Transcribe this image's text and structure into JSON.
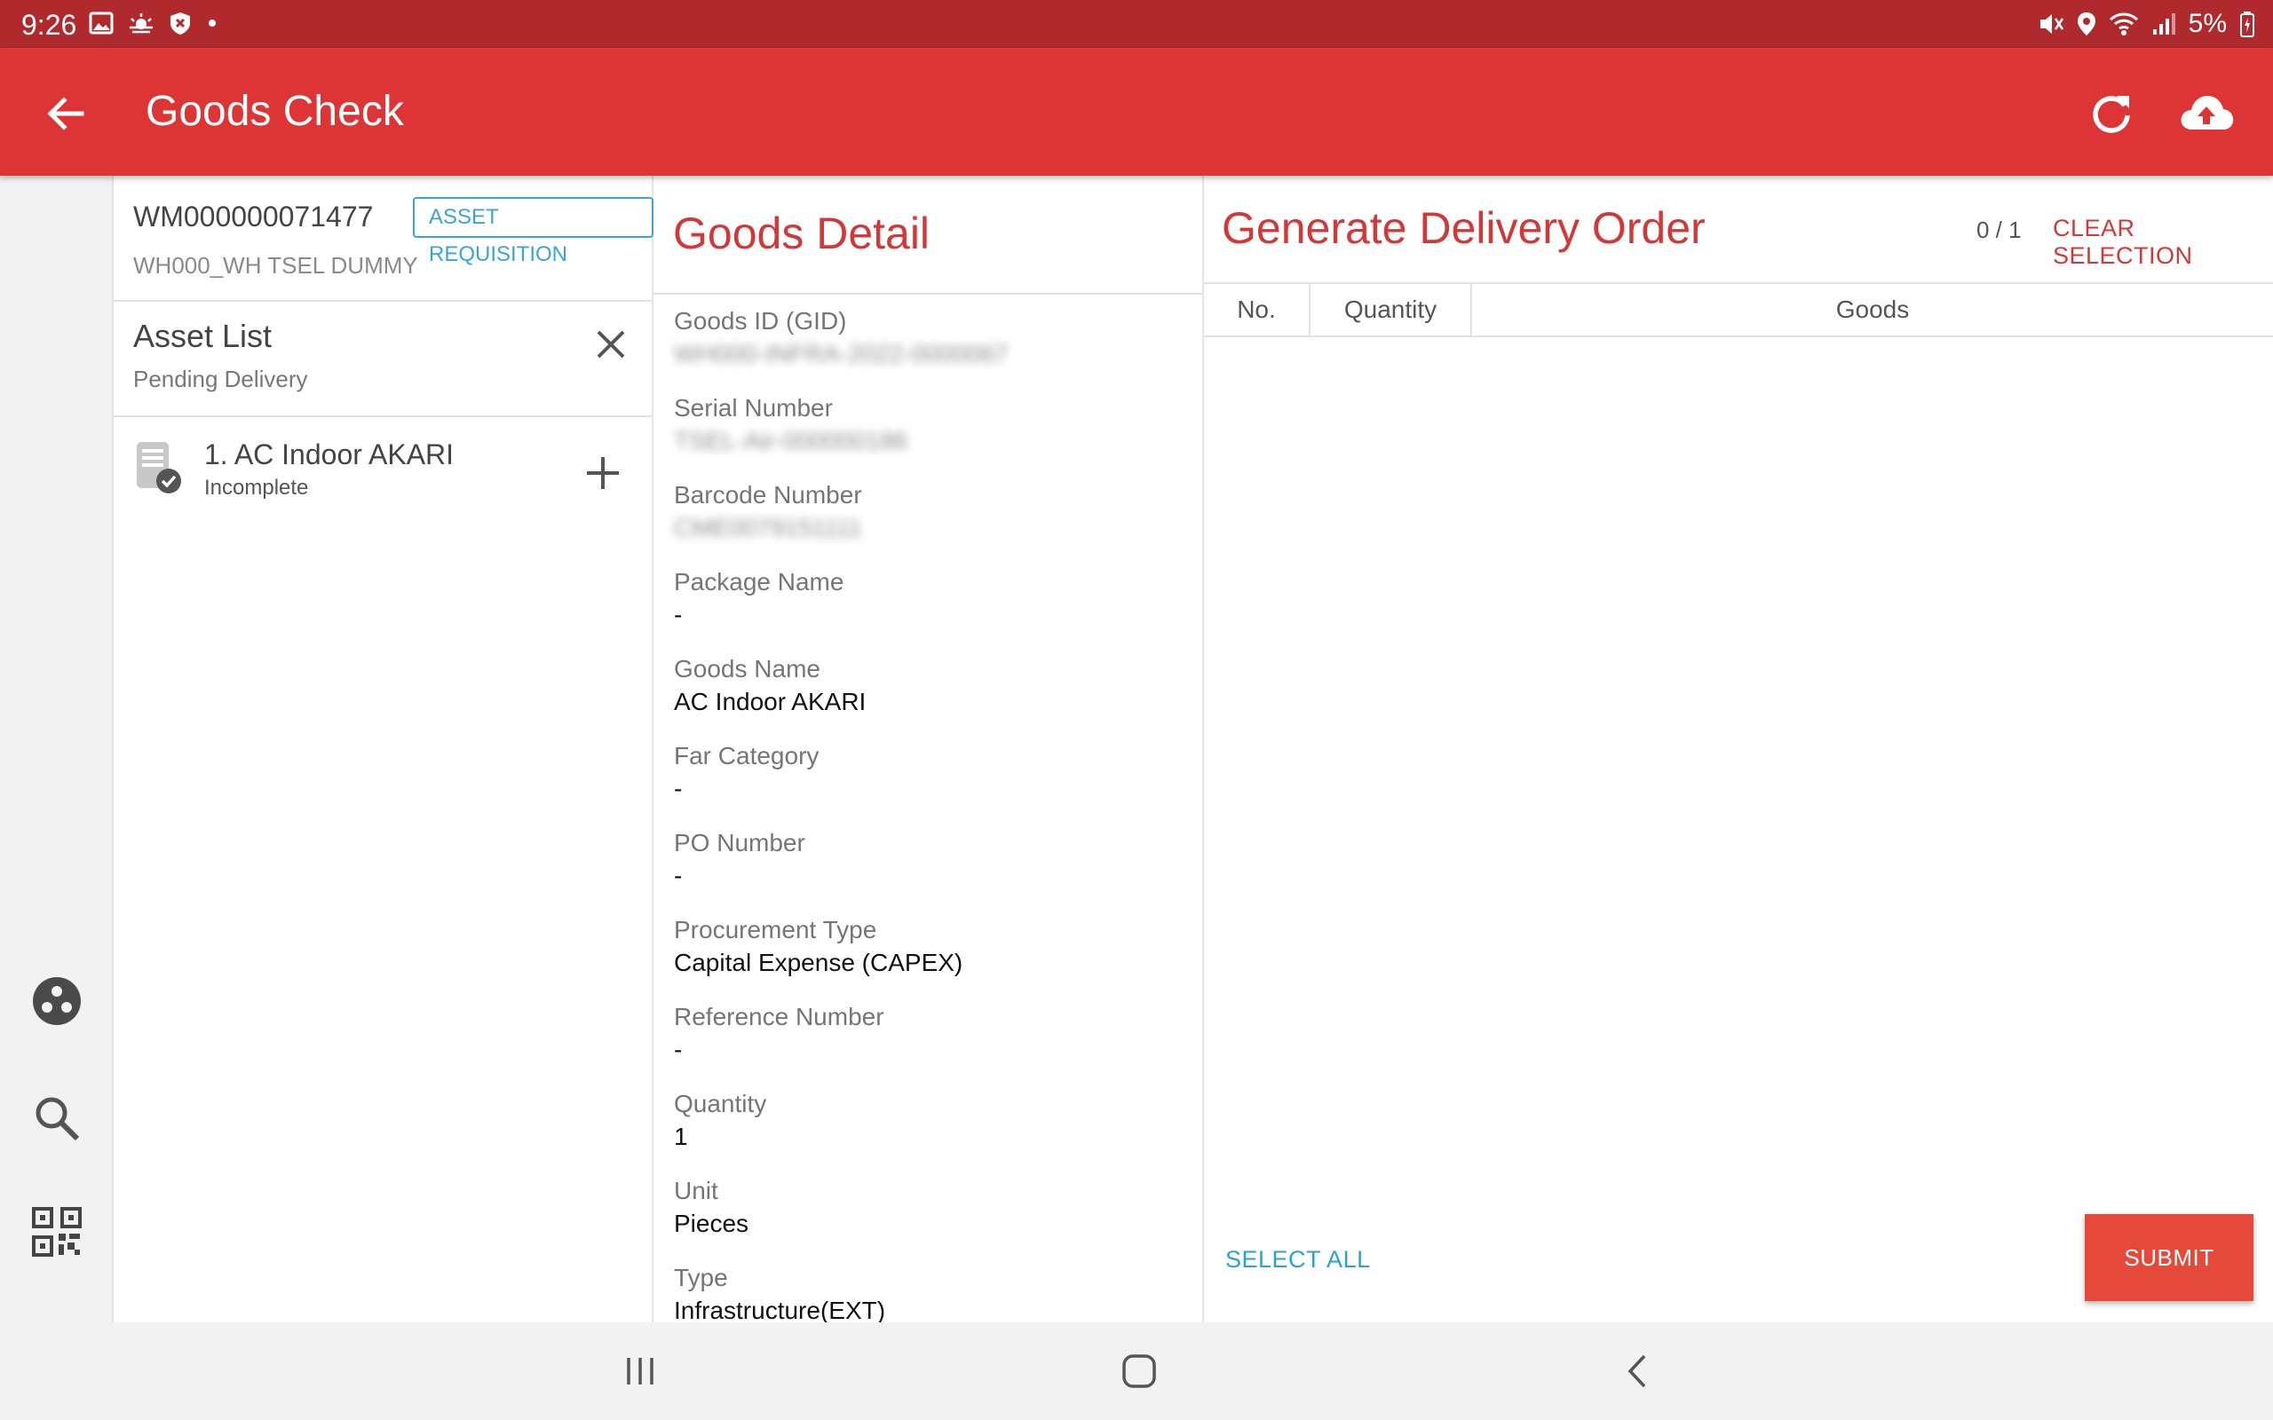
{
  "status_bar": {
    "time": "9:26",
    "battery": "5%",
    "left_icons": [
      "image-icon",
      "weather-icon",
      "shield-icon",
      "dot-icon"
    ],
    "right_icons": [
      "mute-icon",
      "location-icon",
      "wifi-icon",
      "signal-icon",
      "battery-icon"
    ]
  },
  "app_bar": {
    "title": "Goods Check",
    "color": "#dd3535"
  },
  "rail": {
    "icons": [
      "apps-icon",
      "search-icon",
      "qr-code-icon"
    ]
  },
  "requisition": {
    "id": "WM000000071477",
    "badge": "ASSET REQUISITION",
    "warehouse": "WH000_WH TSEL DUMMY"
  },
  "asset_list": {
    "title": "Asset List",
    "subtitle": "Pending Delivery",
    "items": [
      {
        "label": "1. AC Indoor AKARI",
        "status": "Incomplete"
      }
    ]
  },
  "goods_detail": {
    "title": "Goods Detail",
    "fields": [
      {
        "label": "Goods ID (GID)",
        "value": "WH000-INFRA-2022-0000067"
      },
      {
        "label": "Serial Number",
        "value": "TSEL-Air-000000186"
      },
      {
        "label": "Barcode Number",
        "value": "CME0079151111"
      },
      {
        "label": "Package Name",
        "value": "-"
      },
      {
        "label": "Goods Name",
        "value": "AC Indoor AKARI"
      },
      {
        "label": "Far Category",
        "value": "-"
      },
      {
        "label": "PO Number",
        "value": "-"
      },
      {
        "label": "Procurement Type",
        "value": "Capital Expense (CAPEX)"
      },
      {
        "label": "Reference Number",
        "value": "-"
      },
      {
        "label": "Quantity",
        "value": "1"
      },
      {
        "label": "Unit",
        "value": "Pieces"
      },
      {
        "label": "Type",
        "value": "Infrastructure(EXT)"
      }
    ]
  },
  "delivery_order": {
    "title": "Generate Delivery Order",
    "count": "0 / 1",
    "clear_label": "CLEAR SELECTION",
    "columns": [
      "No.",
      "Quantity",
      "Goods"
    ],
    "select_all_label": "SELECT ALL",
    "submit_label": "SUBMIT"
  }
}
